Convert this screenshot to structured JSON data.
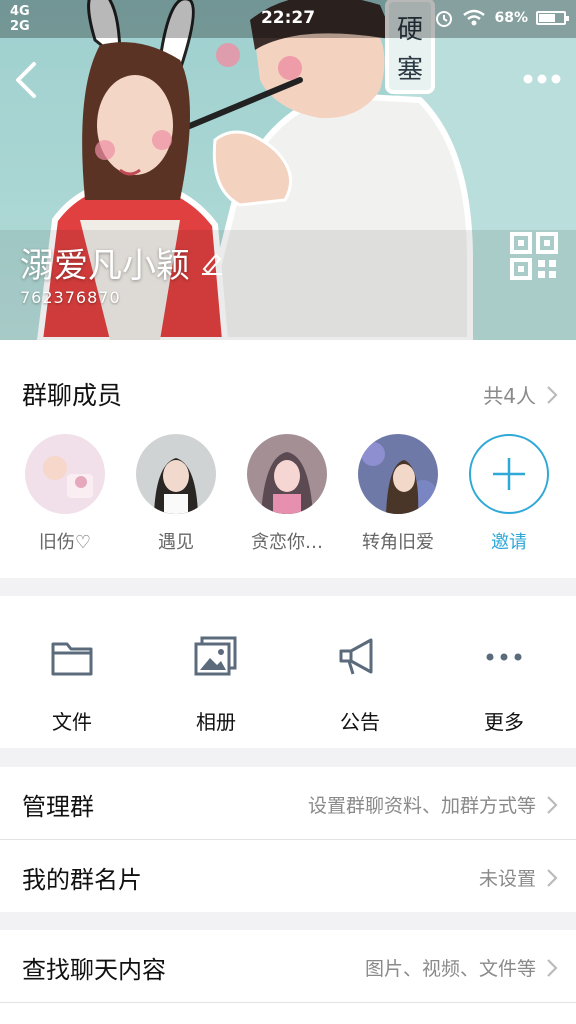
{
  "status_bar": {
    "network_top": "4G",
    "network_bottom": "2G",
    "time": "22:27",
    "battery": "68%",
    "battery_level": 0.68
  },
  "header": {
    "group_name": "溺爱凡小颖",
    "group_id": "762376870",
    "icons": [
      "back-icon",
      "more-icon",
      "qr-code-icon",
      "edit-pencil-icon"
    ]
  },
  "members": {
    "title": "群聊成员",
    "count": "共4人",
    "items": [
      {
        "name": "旧伤♡"
      },
      {
        "name": "遇见"
      },
      {
        "name": "贪恋你…"
      },
      {
        "name": "转角旧爱"
      }
    ],
    "invite_label": "邀请"
  },
  "tools": {
    "items": [
      {
        "label": "文件",
        "icon": "folder-icon"
      },
      {
        "label": "相册",
        "icon": "album-icon"
      },
      {
        "label": "公告",
        "icon": "megaphone-icon"
      },
      {
        "label": "更多",
        "icon": "more-dots-icon"
      }
    ]
  },
  "settings": {
    "manage_label": "管理群",
    "manage_value": "设置群聊资料、加群方式等",
    "card_label": "我的群名片",
    "card_value": "未设置",
    "search_label": "查找聊天内容",
    "search_value": "图片、视频、文件等"
  },
  "colors": {
    "accent": "#2fa8d8",
    "header_bg": "#a9d6d3",
    "page_bg": "#f2f2f4"
  }
}
